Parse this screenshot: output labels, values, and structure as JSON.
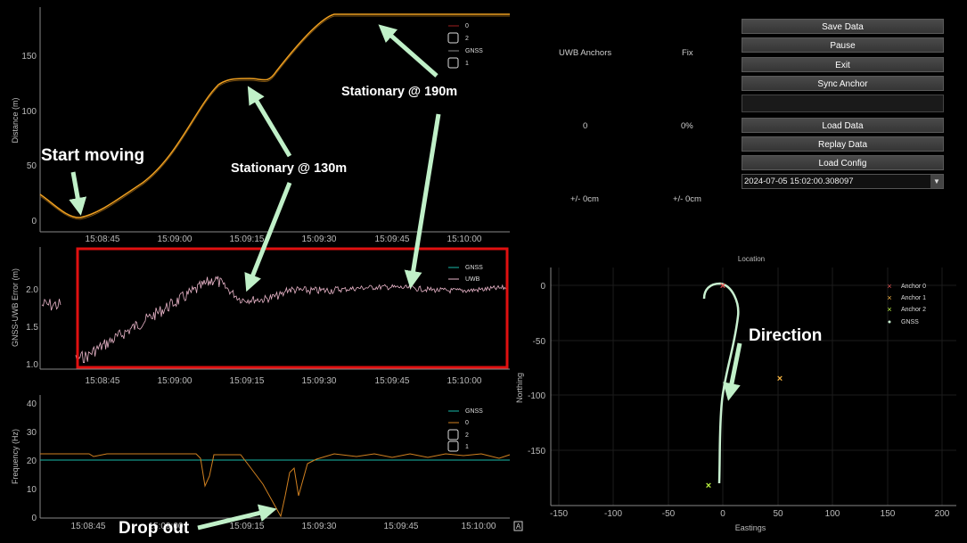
{
  "panels": {
    "distance": {
      "ylabel": "Distance (m)",
      "yticks": [
        "0",
        "50",
        "100",
        "150"
      ],
      "xticks": [
        "15:08:45",
        "15:09:00",
        "15:09:15",
        "15:09:30",
        "15:09:45",
        "15:10:00"
      ],
      "legend": [
        "0",
        "2",
        "GNSS",
        "1"
      ]
    },
    "error": {
      "ylabel": "GNSS-UWB Error (m)",
      "yticks": [
        "1.0",
        "1.5",
        "2.0"
      ],
      "xticks": [
        "15:08:45",
        "15:09:00",
        "15:09:15",
        "15:09:30",
        "15:09:45",
        "15:10:00"
      ],
      "legend": [
        "GNSS",
        "UWB"
      ]
    },
    "frequency": {
      "ylabel": "Frequency (Hz)",
      "yticks": [
        "0",
        "10",
        "20",
        "30",
        "40"
      ],
      "xticks": [
        "15:08:45",
        "15:09:00",
        "15:09:15",
        "15:09:30",
        "15:09:45",
        "15:10:00"
      ],
      "legend": [
        "GNSS",
        "0",
        "2",
        "1"
      ],
      "corner_label": "A"
    },
    "location": {
      "title": "Location",
      "xlabel": "Eastings",
      "ylabel": "Northing",
      "xticks": [
        "-150",
        "-100",
        "-50",
        "0",
        "50",
        "100",
        "150",
        "200"
      ],
      "yticks": [
        "0",
        "-50",
        "-100",
        "-150"
      ],
      "legend": [
        "Anchor 0",
        "Anchor 1",
        "Anchor 2",
        "GNSS"
      ]
    }
  },
  "status": {
    "uwb_anchors_label": "UWB Anchors",
    "fix_label": "Fix",
    "uwb_anchors_value": "0",
    "fix_value": "0%",
    "uwb_precision": "+/- 0cm",
    "fix_precision": "+/- 0cm"
  },
  "buttons": {
    "save": "Save Data",
    "pause": "Pause",
    "exit": "Exit",
    "sync": "Sync Anchor",
    "load": "Load Data",
    "replay": "Replay Data",
    "config": "Load Config"
  },
  "dropdown": {
    "value": "2024-07-05 15:02:00.308097"
  },
  "annotations": {
    "start": "Start moving",
    "s130": "Stationary @ 130m",
    "s190": "Stationary @ 190m",
    "direction": "Direction",
    "dropout": "Drop out"
  },
  "colors": {
    "distance_line": "#f0a020",
    "uwb_line": "#e8b4c8",
    "gnss_line": "#18b8a8",
    "freq_line": "#d08020",
    "anchor0": "#e05050",
    "anchor1": "#f0b040",
    "anchor2": "#b8f040",
    "gnss_track": "#c8f0d0",
    "annotation_arrow": "#c0f0c8",
    "highlight_box": "#e01010"
  }
}
